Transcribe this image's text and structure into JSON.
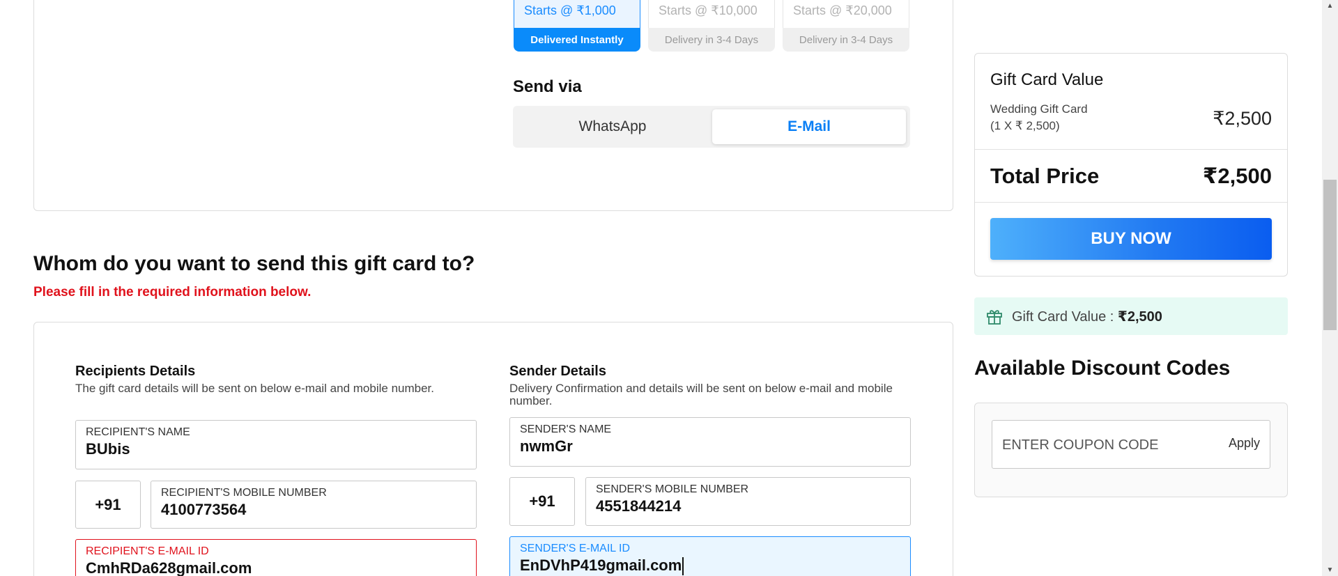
{
  "tiers": [
    {
      "price": "Starts @ ₹1,000",
      "delivery": "Delivered Instantly"
    },
    {
      "price": "Starts @ ₹10,000",
      "delivery": "Delivery in 3-4 Days"
    },
    {
      "price": "Starts @ ₹20,000",
      "delivery": "Delivery in 3-4 Days"
    }
  ],
  "send_via": {
    "label": "Send via",
    "options": [
      "WhatsApp",
      "E-Mail"
    ],
    "selected": "E-Mail"
  },
  "recipient_section": {
    "heading": "Whom do you want to send this gift card to?",
    "warning": "Please fill in the required information below."
  },
  "recipient": {
    "title": "Recipients Details",
    "description": "The gift card details will be sent on below e-mail and mobile number.",
    "name_label": "RECIPIENT'S NAME",
    "name_value": "BUbis",
    "country_code": "+91",
    "mobile_label": "RECIPIENT'S MOBILE NUMBER",
    "mobile_value": "4100773564",
    "email_label": "RECIPIENT'S E-MAIL ID",
    "email_value": "CmhRDa628gmail.com"
  },
  "sender": {
    "title": "Sender Details",
    "description": "Delivery Confirmation and details will be sent on below e-mail and mobile number.",
    "name_label": "SENDER'S NAME",
    "name_value": "nwmGr",
    "country_code": "+91",
    "mobile_label": "SENDER'S MOBILE NUMBER",
    "mobile_value": "4551844214",
    "email_label": "SENDER'S E-MAIL ID",
    "email_value": "EnDVhP419gmail.com"
  },
  "summary": {
    "title": "Gift Card Value",
    "item_name": "Wedding Gift Card",
    "item_qty": "(1 X ₹ 2,500)",
    "item_price": "₹2,500",
    "total_label": "Total Price",
    "total_value": "₹2,500",
    "buy_label": "BUY NOW"
  },
  "gift_value_strip": {
    "label": "Gift Card Value : ",
    "value": "₹2,500",
    "icon": "gift-icon"
  },
  "discount": {
    "title": "Available Discount Codes",
    "placeholder": "ENTER COUPON CODE",
    "apply_label": "Apply"
  },
  "colors": {
    "accent": "#0a8bfa",
    "error": "#e0121c",
    "strip_bg": "#e6faf4"
  }
}
